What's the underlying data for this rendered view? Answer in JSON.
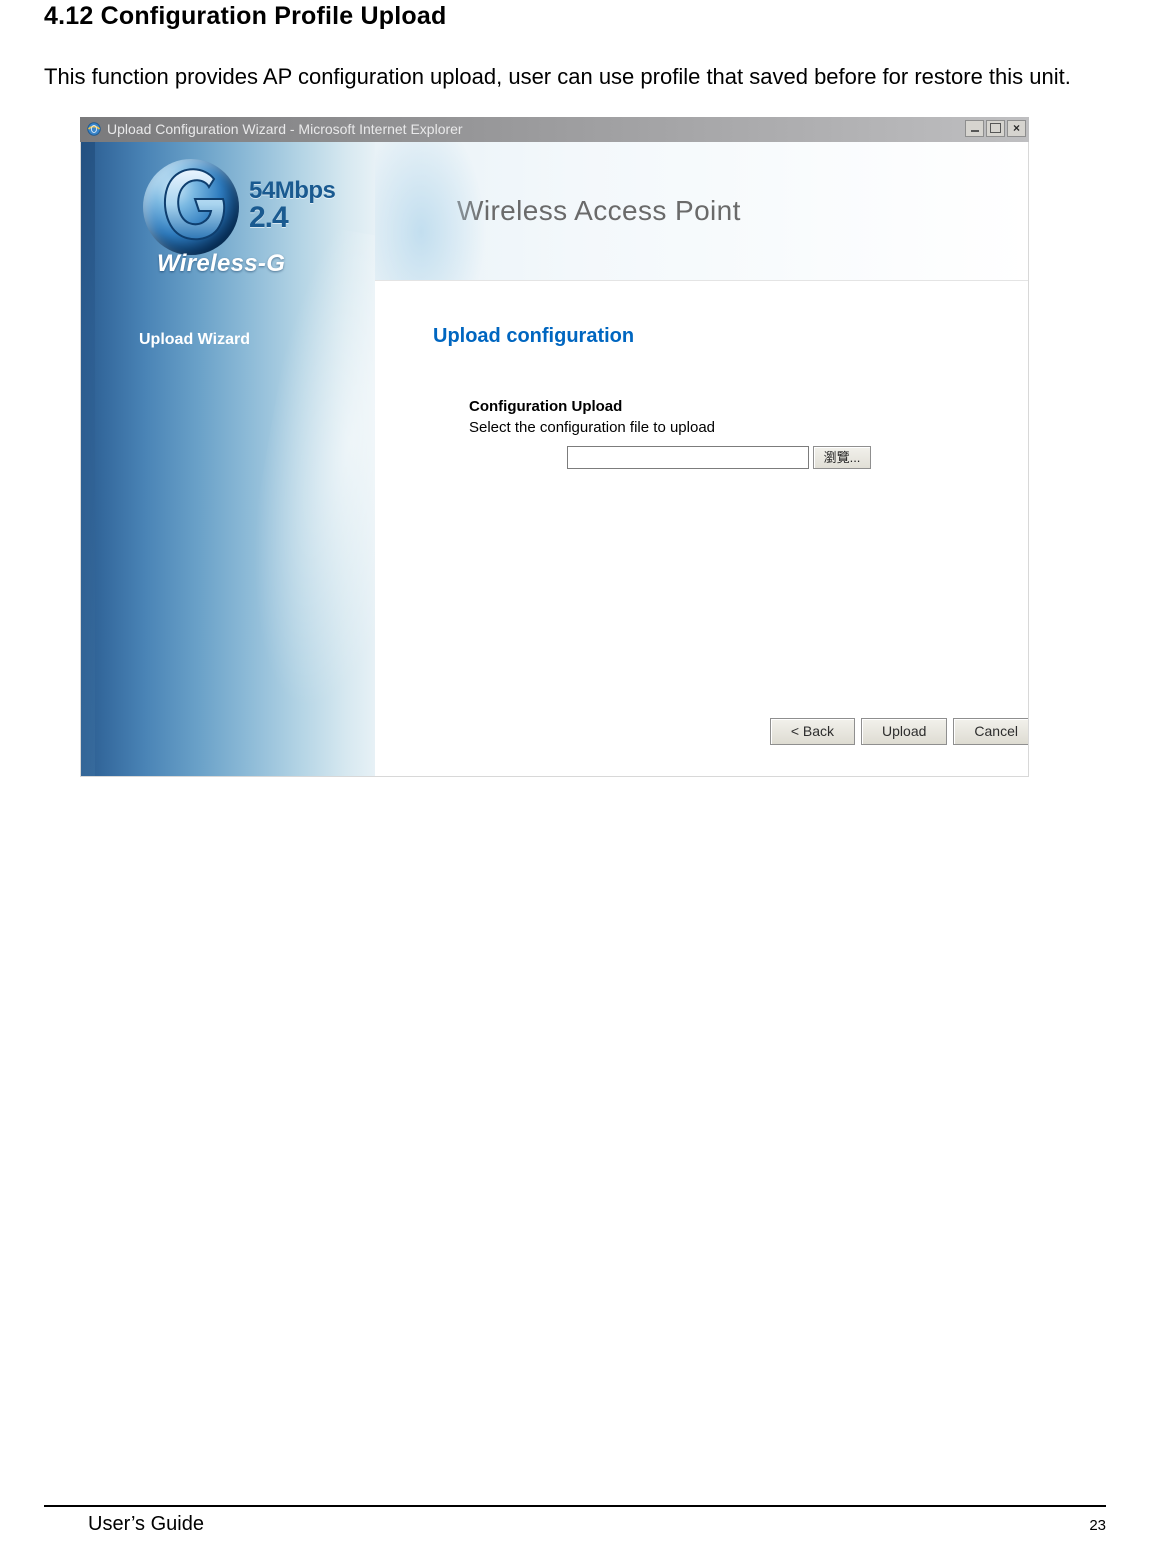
{
  "doc": {
    "section_heading": "4.12 Configuration Profile Upload",
    "intro": "This function provides AP configuration upload, user can use profile that saved before for restore this unit.",
    "footer_left": "User’s Guide",
    "footer_right": "23"
  },
  "window": {
    "title": "Upload Configuration Wizard - Microsoft Internet Explorer"
  },
  "logo": {
    "speed": "54Mbps",
    "ghz": "2.4",
    "brand": "Wireless-G"
  },
  "sidebar": {
    "nav_label": "Upload Wizard"
  },
  "banner": {
    "title": "Wireless Access Point"
  },
  "content": {
    "section_label": "Upload configuration",
    "form_heading": "Configuration Upload",
    "form_sub": "Select the configuration file to upload",
    "file_value": "",
    "browse_label": "瀏覽...",
    "buttons": {
      "back": "< Back",
      "upload": "Upload",
      "cancel": "Cancel"
    }
  }
}
